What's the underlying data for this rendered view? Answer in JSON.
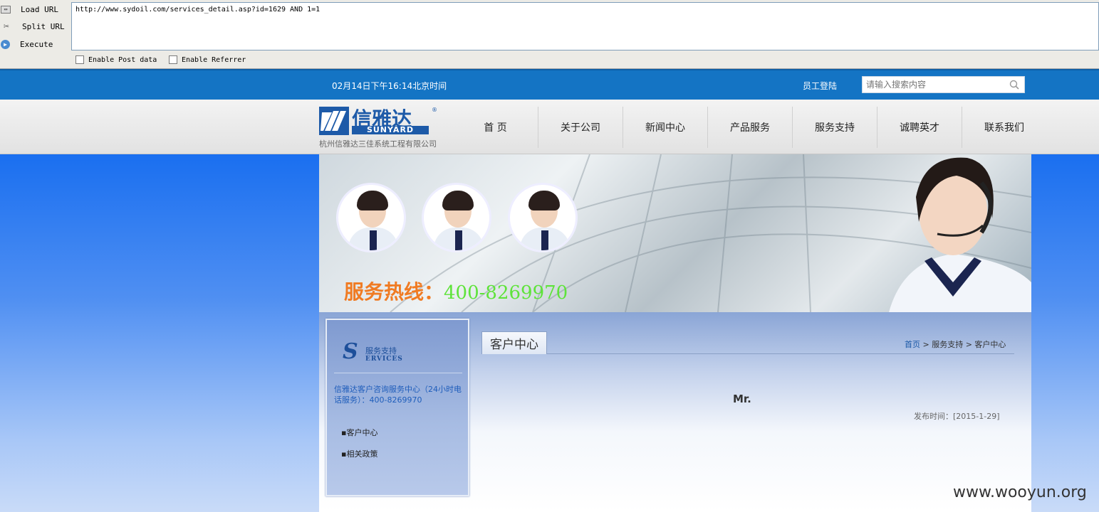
{
  "hackbar": {
    "load_label": "Load URL",
    "split_label": "Split URL",
    "execute_label": "Execute",
    "url_value": "http://www.sydoil.com/services_detail.asp?id=1629 AND 1=1",
    "post_label": "Enable Post data",
    "referrer_label": "Enable Referrer"
  },
  "topbar": {
    "datetime": "02月14日下午16:14北京时间",
    "login": "员工登陆",
    "search_placeholder": "请输入搜索内容"
  },
  "logo": {
    "cn": "信雅达",
    "reg": "®",
    "en": "SUNYARD",
    "company": "杭州信雅达三佳系统工程有限公司"
  },
  "nav": {
    "items": [
      "首 页",
      "关于公司",
      "新闻中心",
      "产品服务",
      "服务支持",
      "诚聘英才",
      "联系我们"
    ]
  },
  "banner": {
    "hotline_label": "服务热线：",
    "hotline_number": "400-8269970"
  },
  "sidebar": {
    "logo_letter": "S",
    "logo_cn": "服务支持",
    "logo_en": "ERVICES",
    "info": "信雅达客户咨询服务中心（24小时电话服务）：400-8269970",
    "items": [
      "▪客户中心",
      "▪相关政策"
    ]
  },
  "main": {
    "section_title": "客户中心",
    "breadcrumb_home": "首页",
    "breadcrumb_rest": " > 服务支持 > 客户中心",
    "article_title": "Mr.",
    "publish_date": "发布时间：[2015-1-29]"
  },
  "watermark": "www.wooyun.org",
  "colors": {
    "topbar_blue": "#1474c4",
    "page_blue": "#1a6ff0",
    "brand_blue": "#1d5aa8",
    "hotline_orange": "#f07b23",
    "hotline_green": "#5ee33a"
  }
}
